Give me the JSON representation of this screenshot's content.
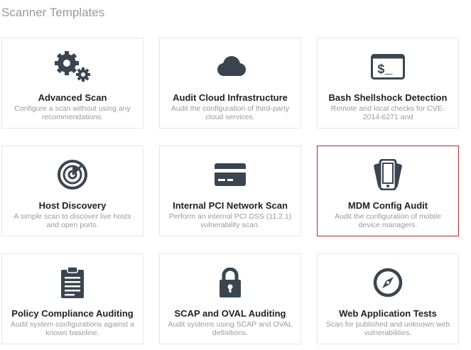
{
  "page": {
    "title": "Scanner Templates"
  },
  "colors": {
    "icon": "#3a4550",
    "selected_border": "#b22a2a"
  },
  "templates": [
    {
      "title": "Advanced Scan",
      "description": "Configure a scan without using any recommendations.",
      "icon": "gears-icon",
      "selected": false
    },
    {
      "title": "Audit Cloud Infrastructure",
      "description": "Audit the configuration of third-party cloud services.",
      "icon": "cloud-icon",
      "selected": false
    },
    {
      "title": "Bash Shellshock Detection",
      "description": "Remote and local checks for CVE-2014-6271 and",
      "icon": "terminal-icon",
      "selected": false
    },
    {
      "title": "Host Discovery",
      "description": "A simple scan to discover live hosts and open ports.",
      "icon": "radar-icon",
      "selected": false
    },
    {
      "title": "Internal PCI Network Scan",
      "description": "Perform an internal PCI DSS (11.2.1) vulnerability scan.",
      "icon": "credit-card-icon",
      "selected": false
    },
    {
      "title": "MDM Config Audit",
      "description": "Audit the configuration of mobile device managers.",
      "icon": "mobile-devices-icon",
      "selected": true
    },
    {
      "title": "Policy Compliance Auditing",
      "description": "Audit system configurations against a known baseline.",
      "icon": "clipboard-icon",
      "selected": false
    },
    {
      "title": "SCAP and OVAL Auditing",
      "description": "Audit systems using SCAP and OVAL definitions.",
      "icon": "lock-icon",
      "selected": false
    },
    {
      "title": "Web Application Tests",
      "description": "Scan for published and unknown web vulnerabilities.",
      "icon": "compass-icon",
      "selected": false
    }
  ]
}
